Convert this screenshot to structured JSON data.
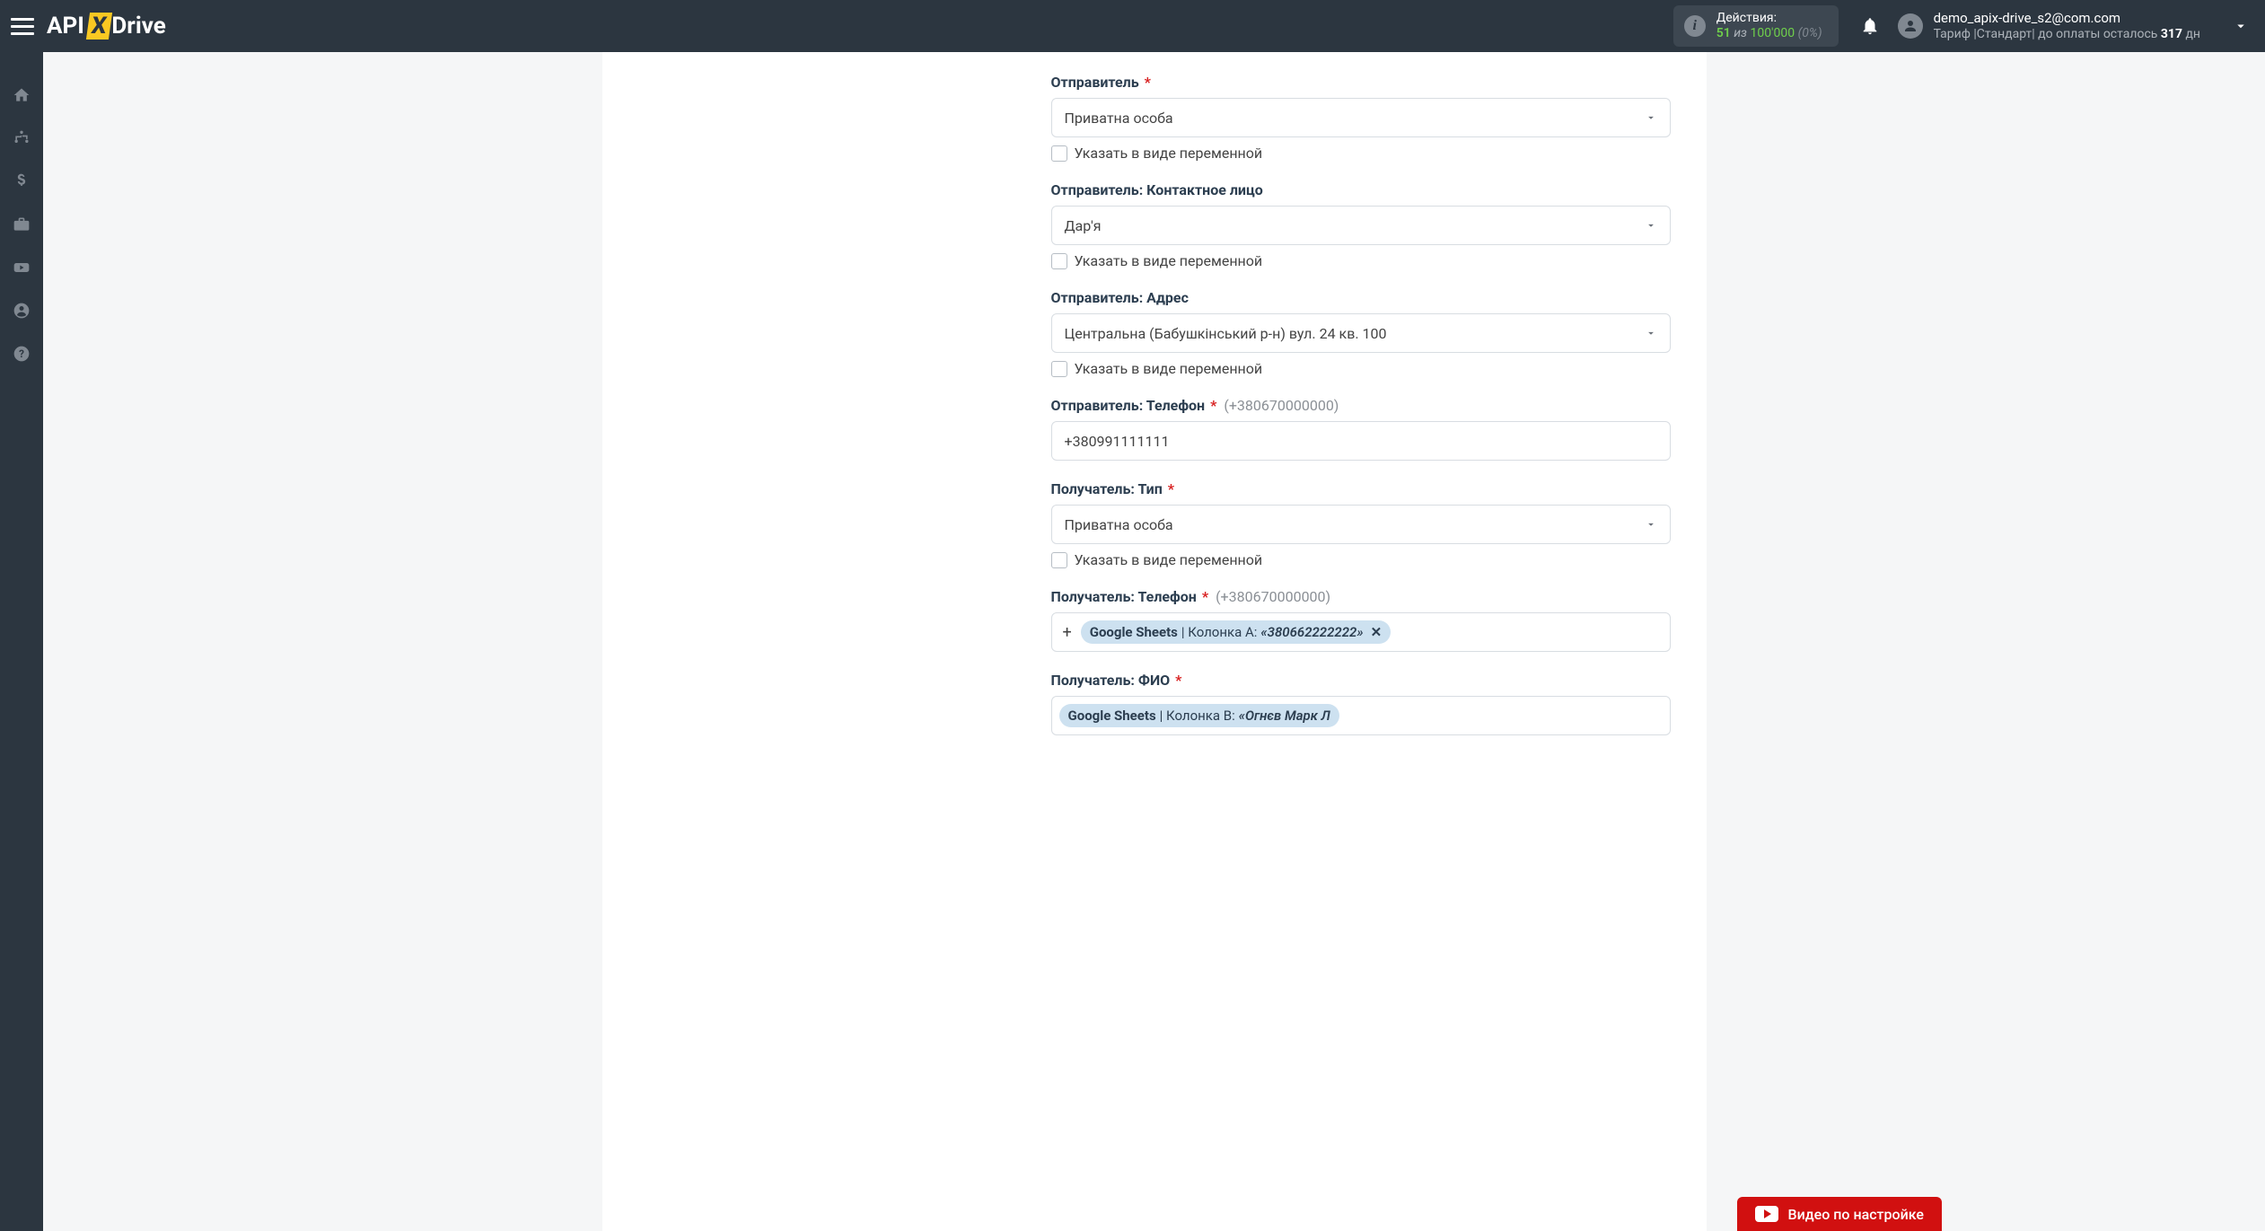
{
  "header": {
    "actions_label": "Действия:",
    "actions_count": "51",
    "actions_of": "из",
    "actions_total": "100'000",
    "actions_pct": "(0%)",
    "email": "demo_apix-drive_s2@com.com",
    "tariff_prefix": "Тариф |Стандарт| до оплаты осталось",
    "tariff_days": "317",
    "tariff_suffix": "дн"
  },
  "form": {
    "sender_label": "Отправитель",
    "sender_value": "Приватна особа",
    "var_checkbox_label": "Указать в виде переменной",
    "sender_contact_label": "Отправитель: Контактное лицо",
    "sender_contact_value": "Дар'я",
    "sender_address_label": "Отправитель: Адрес",
    "sender_address_value": "Центральна (Бабушкінський р-н) вул. 24 кв. 100",
    "sender_phone_label": "Отправитель: Телефон",
    "sender_phone_hint": "(+380670000000)",
    "sender_phone_value": "+380991111111",
    "recipient_type_label": "Получатель: Тип",
    "recipient_type_value": "Приватна особа",
    "recipient_phone_label": "Получатель: Телефон",
    "recipient_phone_hint": "(+380670000000)",
    "recipient_phone_token_src": "Google Sheets",
    "recipient_phone_token_col": " | Колонка A: ",
    "recipient_phone_token_val": "«380662222222»",
    "recipient_fio_label": "Получатель: ФИО",
    "recipient_fio_token_src": "Google Sheets",
    "recipient_fio_token_col": " | Колонка B: ",
    "recipient_fio_token_val": "«Огнєв Марк Л"
  },
  "video_btn_label": "Видео по настройке",
  "logo": {
    "api": "API",
    "x": "X",
    "drive": "Drive"
  }
}
